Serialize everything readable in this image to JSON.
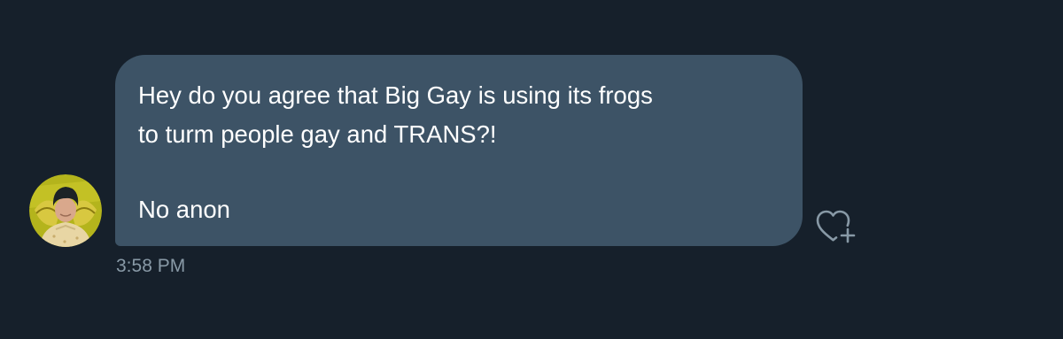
{
  "conversation": {
    "message": {
      "lines": [
        "Hey do you agree that Big Gay is using its frogs",
        "to turm people gay and TRANS?!",
        "No anon"
      ],
      "timestamp": "3:58 PM"
    },
    "sender_avatar_icon": "avatar",
    "like_icon": "heart-plus-icon"
  },
  "colors": {
    "background": "#16202b",
    "bubble": "#3d5366",
    "text": "#ffffff",
    "secondary_text": "#8899a6",
    "icon": "#8899a6"
  }
}
